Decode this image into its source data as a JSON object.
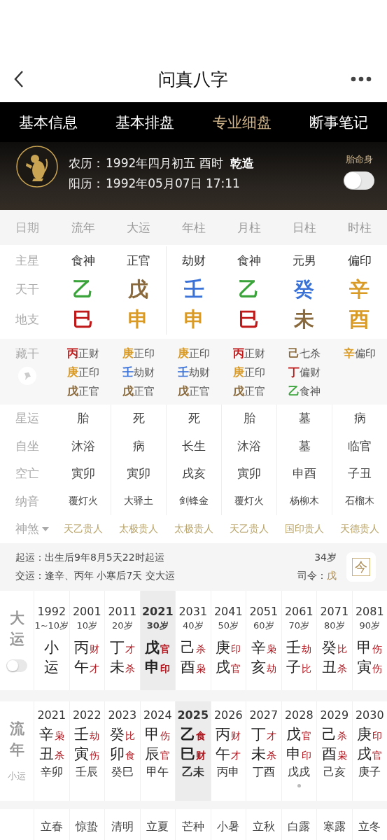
{
  "nav": {
    "title": "问真八字"
  },
  "tabs": [
    {
      "label": "基本信息",
      "selected": false
    },
    {
      "label": "基本排盘",
      "selected": false
    },
    {
      "label": "专业细盘",
      "selected": true
    },
    {
      "label": "断事笔记",
      "selected": false
    }
  ],
  "profile": {
    "lunar_label": "农历：",
    "lunar": "1992年四月初五 酉时",
    "gender": "乾造",
    "solar_label": "阳历：",
    "solar": "1992年05月07日 17:11",
    "toggle": {
      "label": "胎命身",
      "on": false
    }
  },
  "row_labels": {
    "date": "日期",
    "main_star": "主星",
    "stem": "天干",
    "branch": "地支",
    "hidden": "藏干",
    "star_luck": "星运",
    "self_seat": "自坐",
    "void": "空亡",
    "nayin": "纳音",
    "shensha": "神煞"
  },
  "pillars": [
    {
      "header": "流年",
      "main_star": "食神",
      "stem": {
        "char": "乙",
        "color": "#3aa33a"
      },
      "branch": {
        "char": "巳",
        "color": "#c01818"
      },
      "hidden": [
        {
          "stem": "丙",
          "color": "#c01818",
          "god": "正财"
        },
        {
          "stem": "庚",
          "color": "#d99a26",
          "god": "正印"
        },
        {
          "stem": "戊",
          "color": "#8a6a3c",
          "god": "正官"
        }
      ],
      "star_luck": "胎",
      "self_seat": "沐浴",
      "void": "寅卯",
      "nayin": "覆灯火",
      "shensha": "天乙贵人"
    },
    {
      "header": "大运",
      "main_star": "正官",
      "stem": {
        "char": "戊",
        "color": "#8a6a3c"
      },
      "branch": {
        "char": "申",
        "color": "#d99a26"
      },
      "hidden": [
        {
          "stem": "庚",
          "color": "#d99a26",
          "god": "正印"
        },
        {
          "stem": "壬",
          "color": "#3a72d8",
          "god": "劫财"
        },
        {
          "stem": "戊",
          "color": "#8a6a3c",
          "god": "正官"
        }
      ],
      "star_luck": "死",
      "self_seat": "病",
      "void": "寅卯",
      "nayin": "大驿土",
      "shensha": "太极贵人"
    },
    {
      "header": "年柱",
      "main_star": "劫财",
      "stem": {
        "char": "壬",
        "color": "#3a72d8"
      },
      "branch": {
        "char": "申",
        "color": "#d99a26"
      },
      "hidden": [
        {
          "stem": "庚",
          "color": "#d99a26",
          "god": "正印"
        },
        {
          "stem": "壬",
          "color": "#3a72d8",
          "god": "劫财"
        },
        {
          "stem": "戊",
          "color": "#8a6a3c",
          "god": "正官"
        }
      ],
      "star_luck": "死",
      "self_seat": "长生",
      "void": "戌亥",
      "nayin": "剑锋金",
      "shensha": "太极贵人"
    },
    {
      "header": "月柱",
      "main_star": "食神",
      "stem": {
        "char": "乙",
        "color": "#3aa33a"
      },
      "branch": {
        "char": "巳",
        "color": "#c01818"
      },
      "hidden": [
        {
          "stem": "丙",
          "color": "#c01818",
          "god": "正财"
        },
        {
          "stem": "庚",
          "color": "#d99a26",
          "god": "正印"
        },
        {
          "stem": "戊",
          "color": "#8a6a3c",
          "god": "正官"
        }
      ],
      "star_luck": "胎",
      "self_seat": "沐浴",
      "void": "寅卯",
      "nayin": "覆灯火",
      "shensha": "天乙贵人"
    },
    {
      "header": "日柱",
      "main_star": "元男",
      "stem": {
        "char": "癸",
        "color": "#3a72d8"
      },
      "branch": {
        "char": "未",
        "color": "#8a6a3c"
      },
      "hidden": [
        {
          "stem": "己",
          "color": "#8a6a3c",
          "god": "七杀"
        },
        {
          "stem": "丁",
          "color": "#c01818",
          "god": "偏财"
        },
        {
          "stem": "乙",
          "color": "#3aa33a",
          "god": "食神"
        }
      ],
      "star_luck": "墓",
      "self_seat": "墓",
      "void": "申酉",
      "nayin": "杨柳木",
      "shensha": "国印贵人"
    },
    {
      "header": "时柱",
      "main_star": "偏印",
      "stem": {
        "char": "辛",
        "color": "#d99a26"
      },
      "branch": {
        "char": "酉",
        "color": "#d99a26"
      },
      "hidden": [
        {
          "stem": "辛",
          "color": "#d99a26",
          "god": "偏印"
        }
      ],
      "star_luck": "病",
      "self_seat": "临官",
      "void": "子丑",
      "nayin": "石榴木",
      "shensha": "天德贵人"
    }
  ],
  "luck_info": {
    "start": "起运：出生后9年8月5天22时起运",
    "handover": "交运：逢辛、丙年 小寒后7天 交大运",
    "age": "34岁",
    "commander_label": "司令：",
    "commander": "戊",
    "today_button": "今"
  },
  "dayun": {
    "label": "大运",
    "toggle": {
      "on": false
    },
    "items": [
      {
        "year": "1992",
        "age": "1~10岁",
        "stem": "小",
        "branch": "运",
        "selected": false
      },
      {
        "year": "2001",
        "age": "10岁",
        "stem": "丙",
        "stem_god": "财",
        "branch": "午",
        "branch_god": "才",
        "selected": false
      },
      {
        "year": "2011",
        "age": "20岁",
        "stem": "丁",
        "stem_god": "才",
        "branch": "未",
        "branch_god": "杀",
        "selected": false
      },
      {
        "year": "2021",
        "age": "30岁",
        "stem": "戊",
        "stem_god": "官",
        "branch": "申",
        "branch_god": "印",
        "selected": true
      },
      {
        "year": "2031",
        "age": "40岁",
        "stem": "己",
        "stem_god": "杀",
        "branch": "酉",
        "branch_god": "枭",
        "selected": false
      },
      {
        "year": "2041",
        "age": "50岁",
        "stem": "庚",
        "stem_god": "印",
        "branch": "戌",
        "branch_god": "官",
        "selected": false
      },
      {
        "year": "2051",
        "age": "60岁",
        "stem": "辛",
        "stem_god": "枭",
        "branch": "亥",
        "branch_god": "劫",
        "selected": false
      },
      {
        "year": "2061",
        "age": "70岁",
        "stem": "壬",
        "stem_god": "劫",
        "branch": "子",
        "branch_god": "比",
        "selected": false
      },
      {
        "year": "2071",
        "age": "80岁",
        "stem": "癸",
        "stem_god": "比",
        "branch": "丑",
        "branch_god": "杀",
        "selected": false
      },
      {
        "year": "2081",
        "age": "90岁",
        "stem": "甲",
        "stem_god": "伤",
        "branch": "寅",
        "branch_god": "伤",
        "selected": false
      }
    ]
  },
  "liunian": {
    "label": "流年",
    "sublabel": "小运",
    "items": [
      {
        "year": "2021",
        "stem": "辛",
        "stem_god": "枭",
        "branch": "丑",
        "branch_god": "杀",
        "xiaoyun": "辛卯",
        "selected": false,
        "dot": false
      },
      {
        "year": "2022",
        "stem": "壬",
        "stem_god": "劫",
        "branch": "寅",
        "branch_god": "伤",
        "xiaoyun": "壬辰",
        "selected": false,
        "dot": false
      },
      {
        "year": "2023",
        "stem": "癸",
        "stem_god": "比",
        "branch": "卯",
        "branch_god": "食",
        "xiaoyun": "癸巳",
        "selected": false,
        "dot": false
      },
      {
        "year": "2024",
        "stem": "甲",
        "stem_god": "伤",
        "branch": "辰",
        "branch_god": "官",
        "xiaoyun": "甲午",
        "selected": false,
        "dot": false
      },
      {
        "year": "2025",
        "stem": "乙",
        "stem_god": "食",
        "branch": "巳",
        "branch_god": "财",
        "xiaoyun": "乙未",
        "selected": true,
        "dot": false
      },
      {
        "year": "2026",
        "stem": "丙",
        "stem_god": "财",
        "branch": "午",
        "branch_god": "才",
        "xiaoyun": "丙申",
        "selected": false,
        "dot": false
      },
      {
        "year": "2027",
        "stem": "丁",
        "stem_god": "才",
        "branch": "未",
        "branch_god": "杀",
        "xiaoyun": "丁酉",
        "selected": false,
        "dot": false
      },
      {
        "year": "2028",
        "stem": "戊",
        "stem_god": "官",
        "branch": "申",
        "branch_god": "印",
        "xiaoyun": "戊戌",
        "selected": false,
        "dot": true
      },
      {
        "year": "2029",
        "stem": "己",
        "stem_god": "杀",
        "branch": "酉",
        "branch_god": "枭",
        "xiaoyun": "己亥",
        "selected": false,
        "dot": false
      },
      {
        "year": "2030",
        "stem": "庚",
        "stem_god": "印",
        "branch": "戌",
        "branch_god": "官",
        "xiaoyun": "庚子",
        "selected": false,
        "dot": false
      }
    ]
  },
  "solar_terms": [
    "立春",
    "惊蛰",
    "清明",
    "立夏",
    "芒种",
    "小暑",
    "立秋",
    "白露",
    "寒露",
    "立冬"
  ]
}
